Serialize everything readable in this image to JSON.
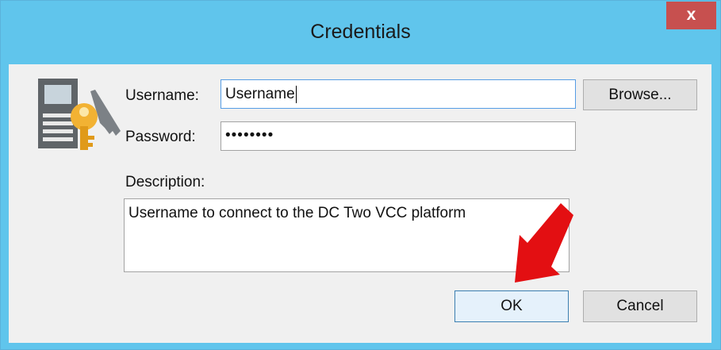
{
  "window": {
    "title": "Credentials",
    "close_label": "x"
  },
  "form": {
    "username_label": "Username:",
    "username_value": "Username",
    "password_label": "Password:",
    "password_mask": "••••••••",
    "description_label": "Description:",
    "description_value": "Username to connect to the DC Two VCC platform"
  },
  "buttons": {
    "browse": "Browse...",
    "ok": "OK",
    "cancel": "Cancel"
  },
  "colors": {
    "title_bar": "#60c5ec",
    "close": "#c7504f",
    "annotation_arrow": "#e30f12"
  },
  "icons": {
    "dialog_icon": "credentials-key-icon",
    "annotation": "red-arrow-icon"
  }
}
